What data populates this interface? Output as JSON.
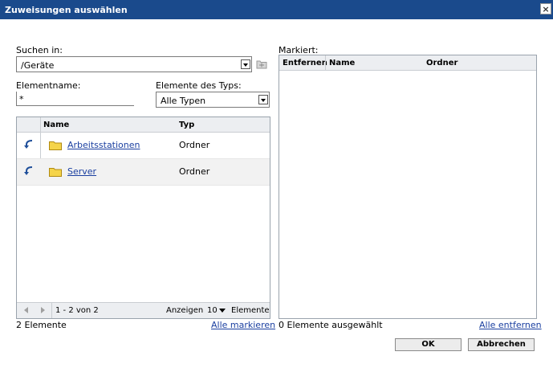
{
  "dialog": {
    "title": "Zuweisungen auswählen",
    "close_glyph": "×"
  },
  "search": {
    "search_in_label": "Suchen in:",
    "search_in_value": "/Geräte",
    "element_name_label": "Elementname:",
    "element_name_value": "*",
    "element_type_label": "Elemente des Typs:",
    "element_type_value": "Alle Typen"
  },
  "browse_table": {
    "columns": [
      "Name",
      "Typ"
    ],
    "rows": [
      {
        "name": "Arbeitsstationen",
        "type": "Ordner",
        "icon": "folder-icon"
      },
      {
        "name": "Server",
        "type": "Ordner",
        "icon": "folder-icon"
      }
    ],
    "pagination": {
      "range": "1 - 2 von 2",
      "show_label": "Anzeigen",
      "page_size": "10",
      "unit": "Elemente"
    },
    "count_text": "2 Elemente",
    "select_all": "Alle markieren"
  },
  "selected": {
    "label": "Markiert:",
    "columns": [
      "Entfernen",
      "Name",
      "Ordner"
    ],
    "count_text": "0 Elemente ausgewählt",
    "remove_all": "Alle entfernen"
  },
  "buttons": {
    "ok": "OK",
    "cancel": "Abbrechen"
  },
  "colors": {
    "titlebar": "#1a4a8c",
    "link": "#1a3fa0",
    "folder": "#f5d44a"
  }
}
